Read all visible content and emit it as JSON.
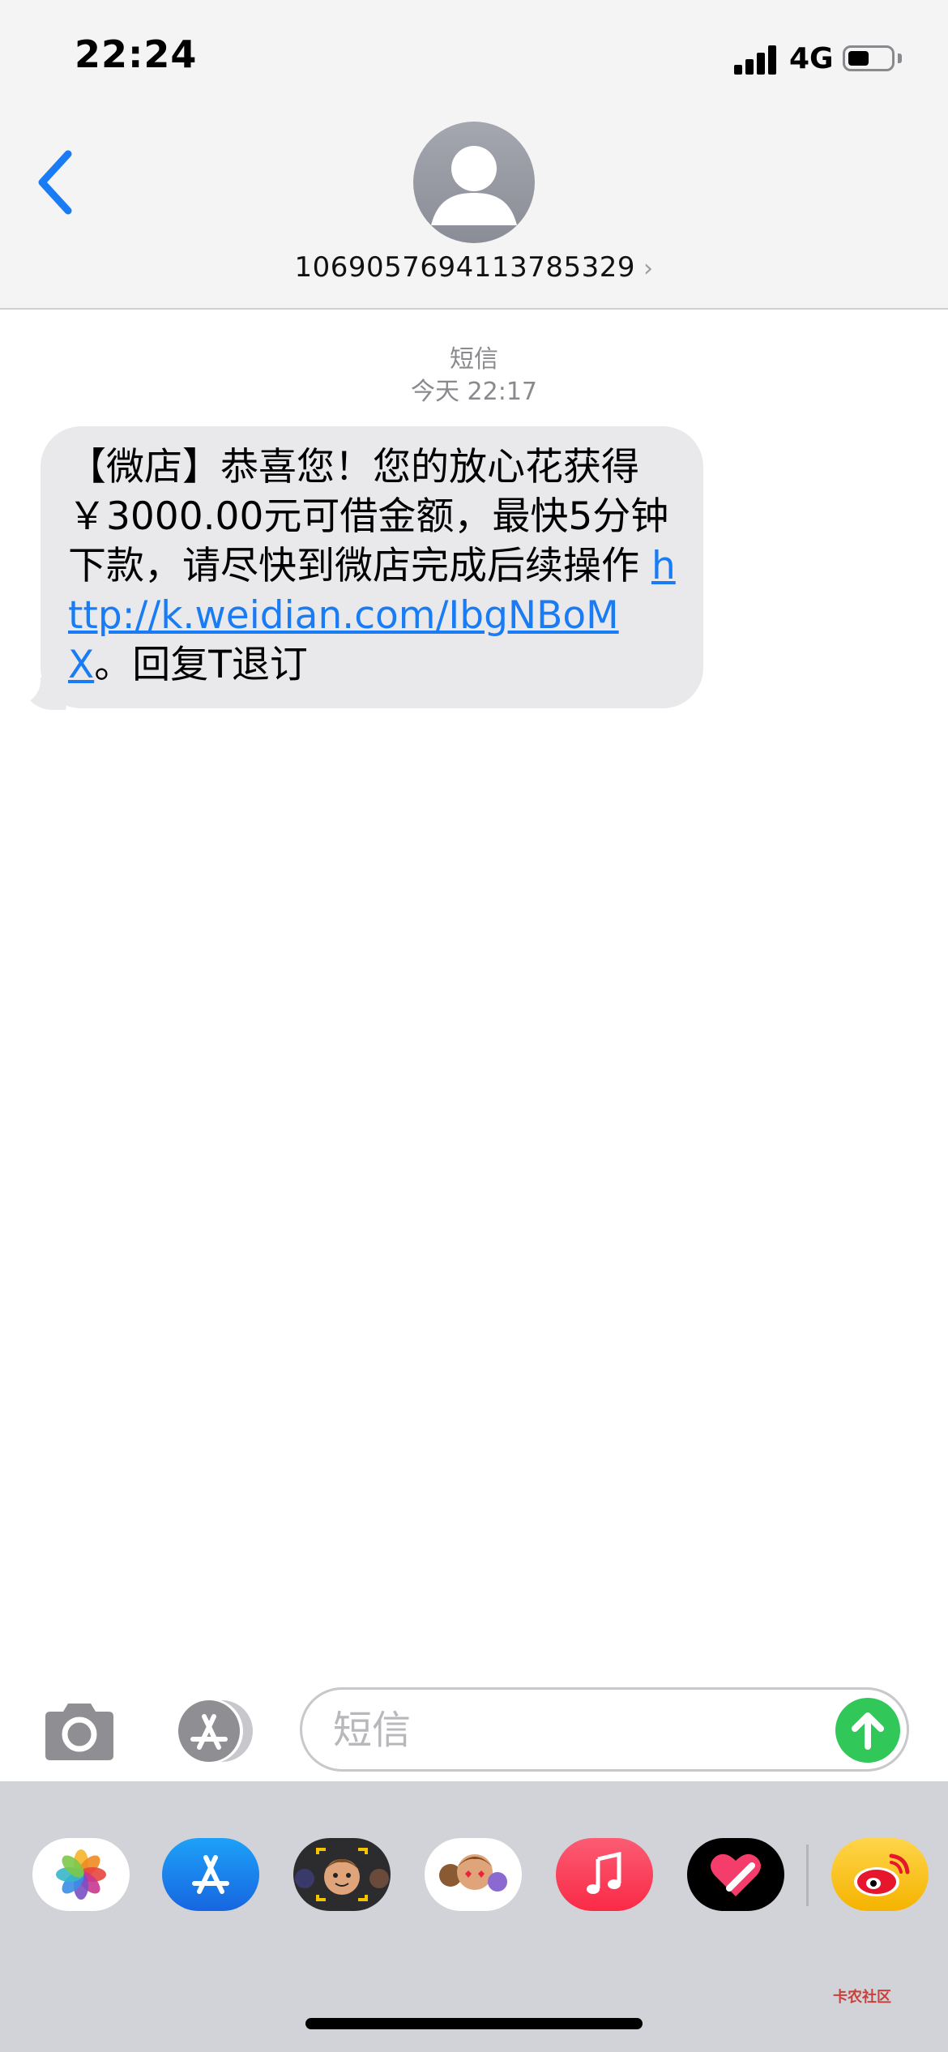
{
  "status_bar": {
    "time": "22:24",
    "network": "4G",
    "battery_level": 0.5,
    "signal_bars": 4
  },
  "header": {
    "back_icon": "chevron-left-icon",
    "avatar_icon": "person-silhouette-icon",
    "contact_number": "1069057694113785329",
    "contact_chevron": "›"
  },
  "thread": {
    "service_label": "短信",
    "timestamp": "今天 22:17",
    "message": {
      "text_before_link": "【微店】恭喜您！您的放心花获得￥3000.00元可借金额，最快5分钟下款，请尽快到微店完成后续操作 ",
      "link": "http://k.weidian.com/IbgNBoMX",
      "text_after_link": "。回复T退订"
    }
  },
  "input_bar": {
    "camera_icon": "camera-icon",
    "apps_icon": "app-store-icon",
    "placeholder": "短信",
    "send_icon": "arrow-up-icon"
  },
  "app_drawer": {
    "apps": [
      {
        "icon": "photos-icon"
      },
      {
        "icon": "app-store-icon"
      },
      {
        "icon": "memoji-camera-icon"
      },
      {
        "icon": "memoji-stickers-icon"
      },
      {
        "icon": "music-icon"
      },
      {
        "icon": "digital-touch-icon"
      },
      {
        "icon": "weibo-icon"
      }
    ],
    "watermark": "卡农社区"
  },
  "colors": {
    "link": "#1a7cf5",
    "send": "#31c759",
    "bubble": "#e9e9eb",
    "header_bg": "#f4f4f5",
    "drawer_bg": "#d1d3d9"
  }
}
